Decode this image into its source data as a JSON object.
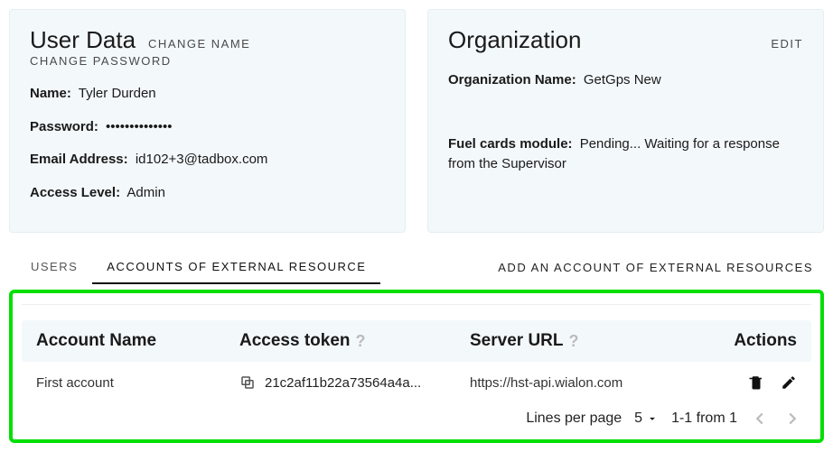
{
  "userCard": {
    "title": "User Data",
    "changeName": "CHANGE NAME",
    "changePassword": "CHANGE PASSWORD",
    "nameLabel": "Name:",
    "nameValue": "Tyler Durden",
    "passwordLabel": "Password:",
    "passwordValue": "••••••••••••••",
    "emailLabel": "Email Address:",
    "emailValue": "id102+3@tadbox.com",
    "accessLabel": "Access Level:",
    "accessValue": "Admin"
  },
  "orgCard": {
    "title": "Organization",
    "edit": "EDIT",
    "orgNameLabel": "Organization Name:",
    "orgNameValue": "GetGps New",
    "fuelLabel": "Fuel cards module:",
    "fuelValue": "Pending... Waiting for a response from the Supervisor"
  },
  "tabs": {
    "users": "USERS",
    "accounts": "ACCOUNTS OF EXTERNAL RESOURCE",
    "addAction": "ADD AN ACCOUNT OF EXTERNAL RESOURCES"
  },
  "table": {
    "headers": {
      "name": "Account Name",
      "token": "Access token",
      "url": "Server URL",
      "actions": "Actions"
    },
    "row": {
      "name": "First account",
      "token": "21c2af11b22a73564a4a...",
      "url": "https://hst-api.wialon.com"
    }
  },
  "pager": {
    "linesLabel": "Lines per page",
    "pageSize": "5",
    "range": "1-1 from 1"
  }
}
